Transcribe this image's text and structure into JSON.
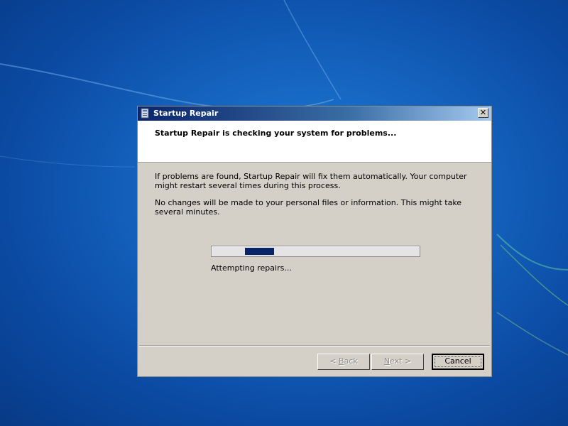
{
  "window": {
    "title": "Startup Repair",
    "close_label": "✕"
  },
  "header": {
    "text": "Startup Repair is checking your system for problems..."
  },
  "body": {
    "paragraph1": "If problems are found, Startup Repair will fix them automatically. Your computer might restart several times during this process.",
    "paragraph2": "No changes will be made to your personal files or information. This might take several minutes."
  },
  "progress": {
    "marquee_segment_start": 0.16,
    "marquee_segment_length": 0.14,
    "status": "Attempting repairs..."
  },
  "buttons": {
    "back": {
      "prefix": "< ",
      "accel": "B",
      "rest": "ack"
    },
    "next": {
      "accel": "N",
      "rest": "ext >"
    },
    "cancel": "Cancel"
  },
  "colors": {
    "progress_fill": "#0a246a",
    "desktop": "#1565c0"
  }
}
